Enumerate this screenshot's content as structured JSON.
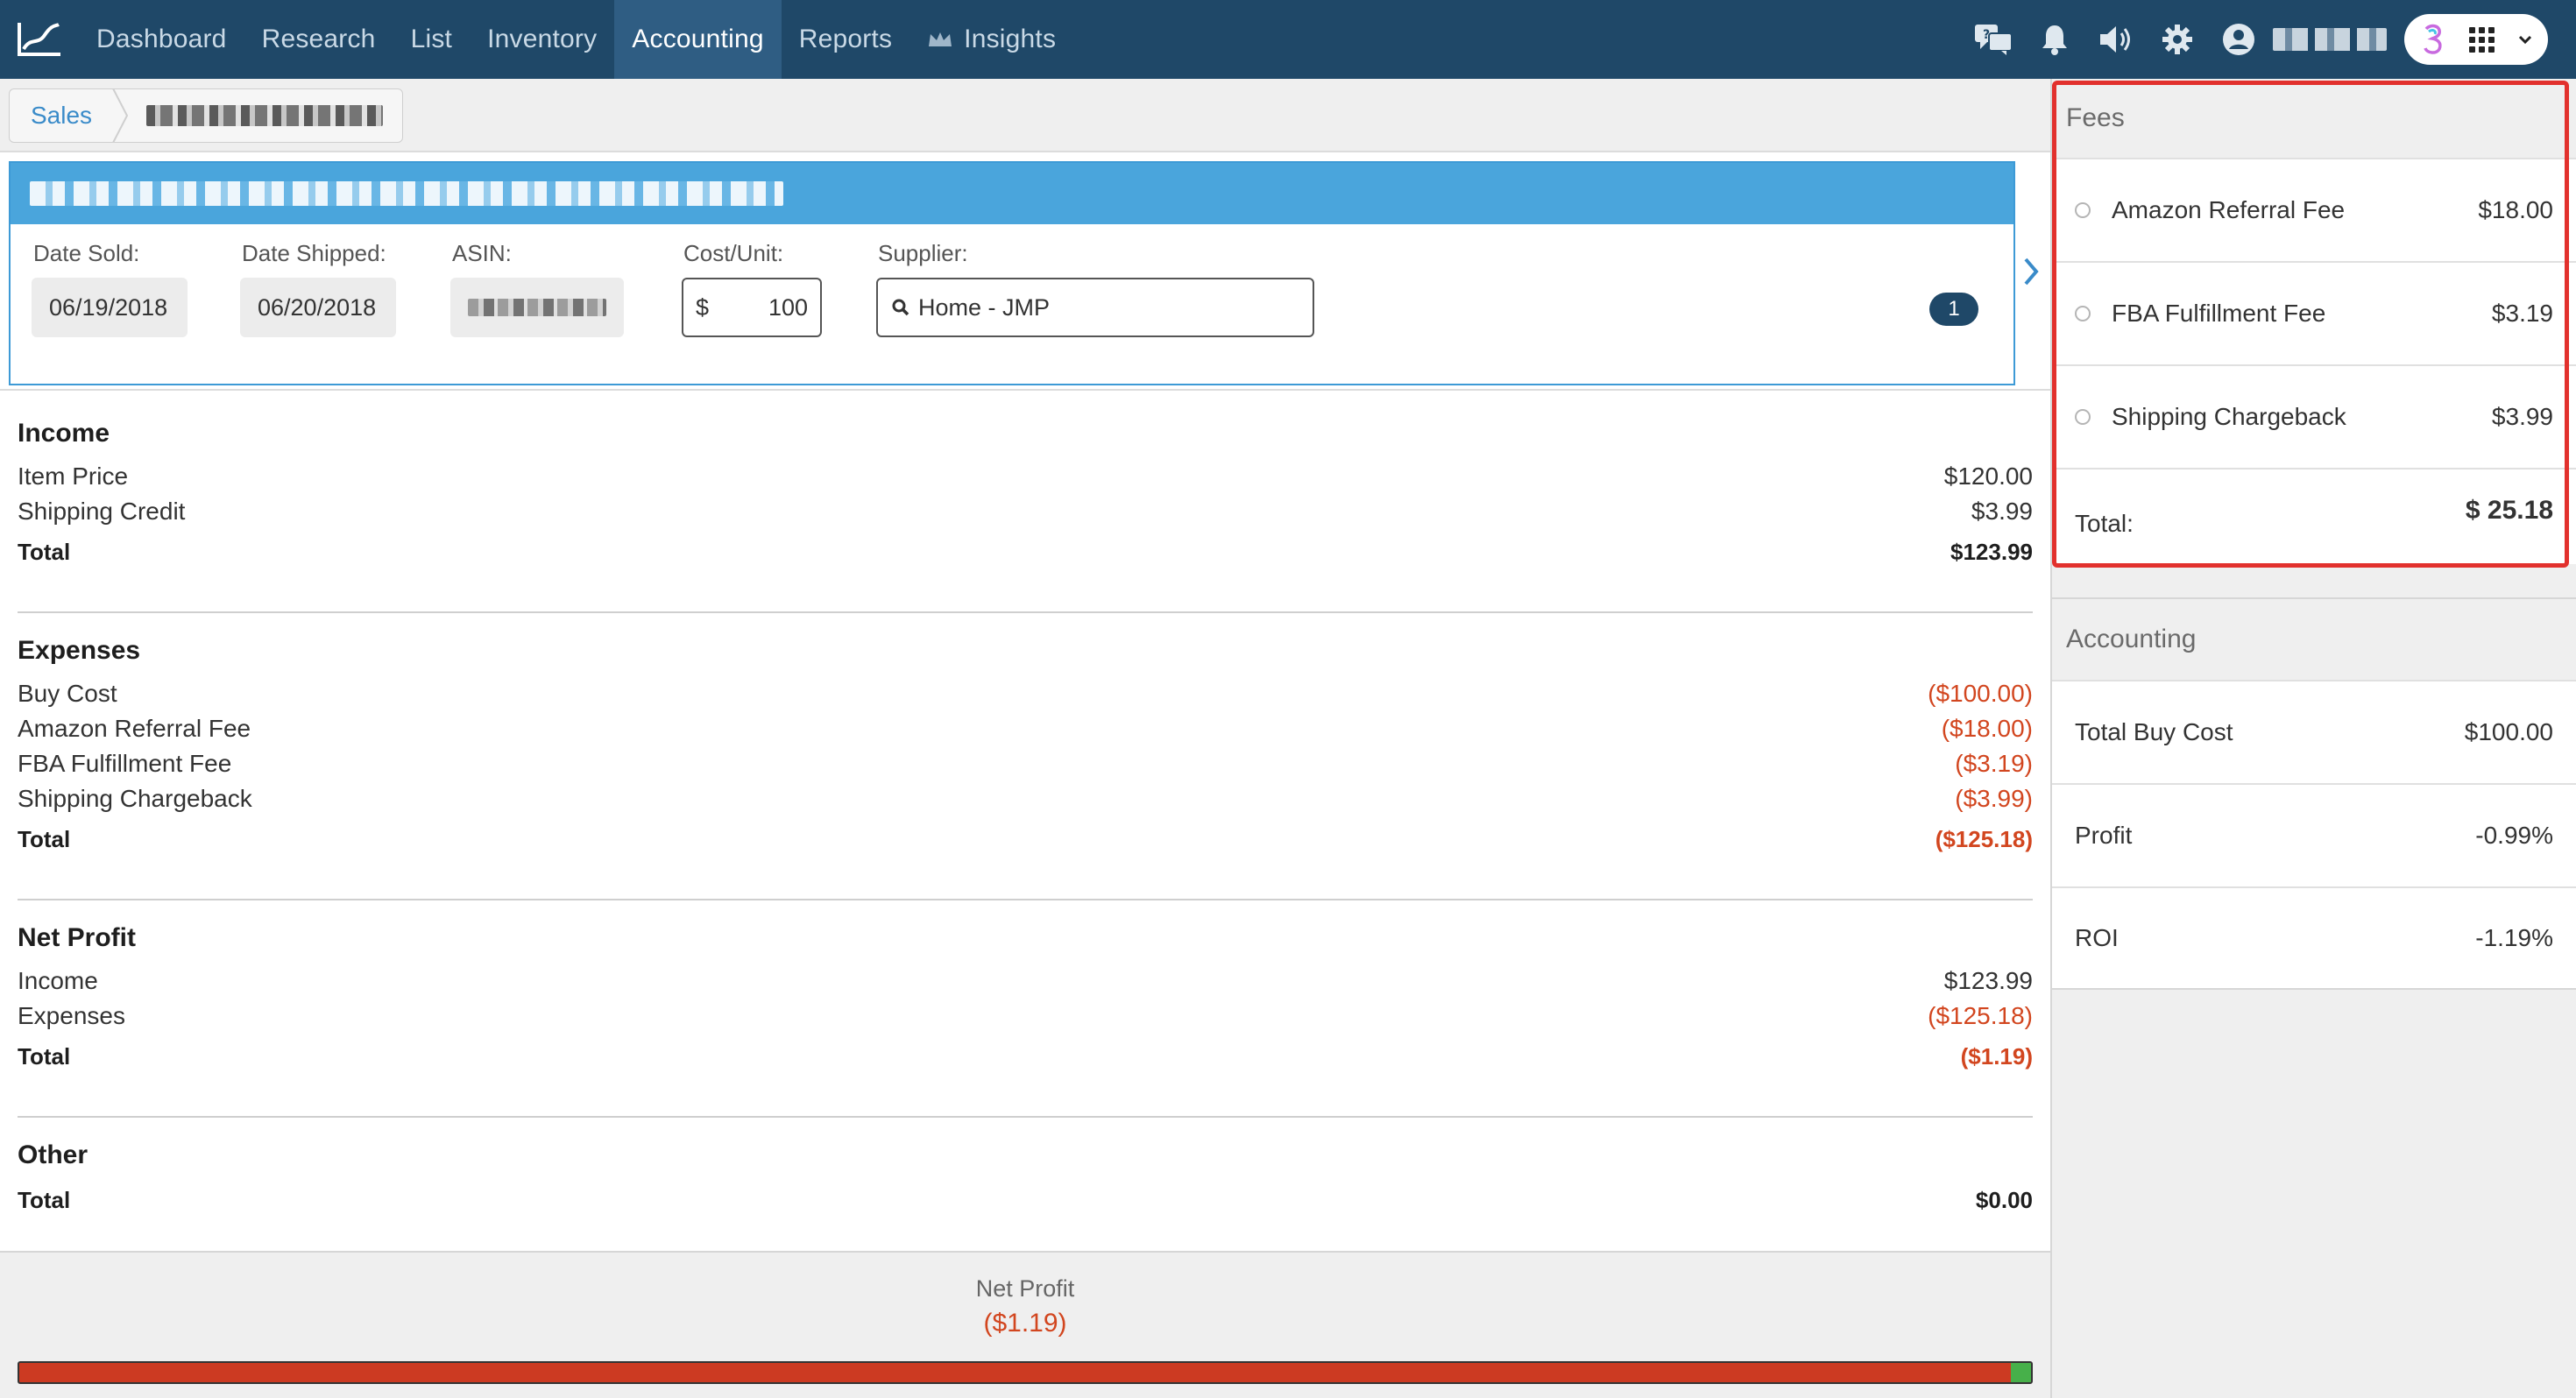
{
  "nav": {
    "items": [
      "Dashboard",
      "Research",
      "List",
      "Inventory",
      "Accounting",
      "Reports",
      "Insights"
    ],
    "active": "Accounting"
  },
  "icons": {
    "logo": "chart-logo-icon",
    "chat": "chat-help-icon",
    "bell": "bell-icon",
    "volume": "speaker-icon",
    "settings": "gear-icon",
    "account": "user-circle-icon",
    "apps": "app-grid-icon"
  },
  "breadcrumb": {
    "first": "Sales"
  },
  "item": {
    "date_sold_label": "Date Sold:",
    "date_sold": "06/19/2018",
    "date_shipped_label": "Date Shipped:",
    "date_shipped": "06/20/2018",
    "asin_label": "ASIN:",
    "cost_label": "Cost/Unit:",
    "cost_currency": "$",
    "cost_value": "100",
    "supplier_label": "Supplier:",
    "supplier_value": "Home - JMP",
    "badge": "1"
  },
  "income": {
    "title": "Income",
    "rows": [
      {
        "label": "Item Price",
        "value": "$120.00"
      },
      {
        "label": "Shipping Credit",
        "value": "$3.99"
      }
    ],
    "total_label": "Total",
    "total": "$123.99"
  },
  "expenses": {
    "title": "Expenses",
    "rows": [
      {
        "label": "Buy Cost",
        "value": "($100.00)"
      },
      {
        "label": "Amazon Referral Fee",
        "value": "($18.00)"
      },
      {
        "label": "FBA Fulfillment Fee",
        "value": "($3.19)"
      },
      {
        "label": "Shipping Chargeback",
        "value": "($3.99)"
      }
    ],
    "total_label": "Total",
    "total": "($125.18)"
  },
  "net_profit": {
    "title": "Net Profit",
    "rows": [
      {
        "label": "Income",
        "value": "$123.99"
      },
      {
        "label": "Expenses",
        "value": "($125.18)"
      }
    ],
    "total_label": "Total",
    "total": "($1.19)"
  },
  "other": {
    "title": "Other",
    "total_label": "Total",
    "total": "$0.00"
  },
  "footer": {
    "label": "Net Profit",
    "value": "($1.19)",
    "profit_share_percent": 1
  },
  "fees": {
    "title": "Fees",
    "rows": [
      {
        "label": "Amazon Referral Fee",
        "value": "$18.00"
      },
      {
        "label": "FBA Fulfillment Fee",
        "value": "$3.19"
      },
      {
        "label": "Shipping Chargeback",
        "value": "$3.99"
      }
    ],
    "total_label": "Total:",
    "total": "$ 25.18"
  },
  "accounting": {
    "title": "Accounting",
    "rows": [
      {
        "label": "Total Buy Cost",
        "value": "$100.00"
      },
      {
        "label": "Profit",
        "value": "-0.99%"
      },
      {
        "label": "ROI",
        "value": "-1.19%"
      }
    ]
  },
  "colors": {
    "nav_bg": "#1f4868",
    "nav_active": "#2f5d83",
    "accent": "#4aa5dc",
    "negative": "#d2461f",
    "highlight_box": "#e2312d",
    "bar_red": "#cc3a22",
    "bar_green": "#47b04a"
  }
}
